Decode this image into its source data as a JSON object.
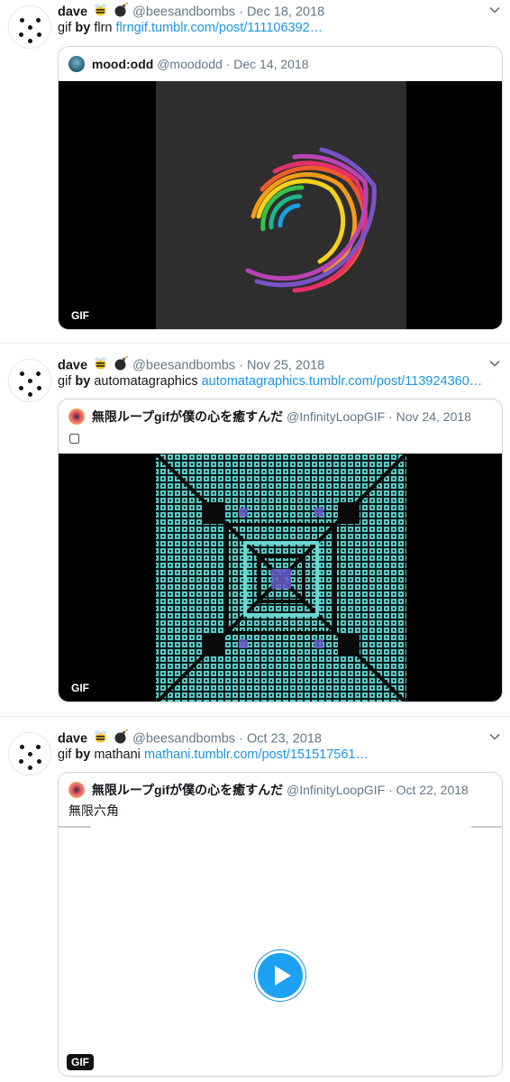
{
  "tweets": [
    {
      "display_name": "dave",
      "handle": "@beesandbombs",
      "date": "Dec 18, 2018",
      "body_prefix": "gif",
      "body_by": "by",
      "body_author": "flrn",
      "body_link": "flrngif.tumblr.com/post/111106392…",
      "quote": {
        "name": "mood:odd",
        "handle": "@moododd",
        "date": "Dec 14, 2018",
        "text": "",
        "media_badge": "GIF"
      }
    },
    {
      "display_name": "dave",
      "handle": "@beesandbombs",
      "date": "Nov 25, 2018",
      "body_prefix": "gif",
      "body_by": "by",
      "body_author": "automatagraphics",
      "body_link": "automatagraphics.tumblr.com/post/113924360…",
      "quote": {
        "name": "無限ループgifが僕の心を癒すんだ",
        "handle": "@InfinityLoopGIF",
        "date": "Nov 24, 2018",
        "text": "▢",
        "media_badge": "GIF"
      }
    },
    {
      "display_name": "dave",
      "handle": "@beesandbombs",
      "date": "Oct 23, 2018",
      "body_prefix": "gif",
      "body_by": "by",
      "body_author": "mathani",
      "body_link": "mathani.tumblr.com/post/151517561…",
      "quote": {
        "name": "無限ループgifが僕の心を癒すんだ",
        "handle": "@InfinityLoopGIF",
        "date": "Oct 22, 2018",
        "text": "無限六角",
        "media_badge": "GIF"
      }
    }
  ],
  "colors": {
    "link": "#1b95e0",
    "muted": "#657786",
    "play_button": "#1da1f2"
  },
  "icons": [
    "bee-emoji",
    "bomb-emoji",
    "chevron-down-icon",
    "play-icon"
  ]
}
